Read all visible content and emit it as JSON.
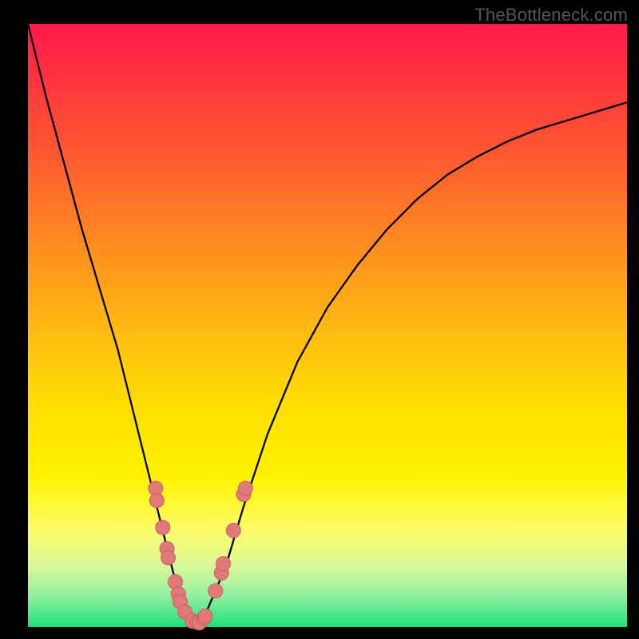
{
  "watermark": "TheBottleneck.com",
  "chart_data": {
    "type": "line",
    "title": "",
    "xlabel": "",
    "ylabel": "",
    "xlim": [
      0,
      100
    ],
    "ylim": [
      0,
      100
    ],
    "series": [
      {
        "name": "curve",
        "x": [
          0,
          3,
          6,
          9,
          12,
          15,
          17,
          19,
          21,
          23,
          24.5,
          26,
          27,
          28,
          29,
          30,
          33,
          36,
          40,
          45,
          50,
          55,
          60,
          65,
          70,
          75,
          80,
          85,
          90,
          95,
          100
        ],
        "values": [
          100,
          88,
          77,
          66,
          56,
          46,
          38,
          30,
          22,
          14,
          8,
          3,
          1,
          0.4,
          1,
          3,
          10,
          20,
          32,
          44,
          53,
          60,
          66,
          71,
          75,
          78,
          80.5,
          82.5,
          84,
          85.5,
          87
        ]
      }
    ],
    "points": [
      {
        "x": 21.3,
        "y": 23.0
      },
      {
        "x": 21.5,
        "y": 21.0
      },
      {
        "x": 22.5,
        "y": 16.5
      },
      {
        "x": 23.2,
        "y": 13.0
      },
      {
        "x": 23.4,
        "y": 11.5
      },
      {
        "x": 24.6,
        "y": 7.5
      },
      {
        "x": 25.1,
        "y": 5.5
      },
      {
        "x": 25.4,
        "y": 4.2
      },
      {
        "x": 26.2,
        "y": 2.5
      },
      {
        "x": 27.4,
        "y": 1.0
      },
      {
        "x": 28.2,
        "y": 0.8
      },
      {
        "x": 28.6,
        "y": 0.7
      },
      {
        "x": 29.4,
        "y": 1.5
      },
      {
        "x": 29.6,
        "y": 1.8
      },
      {
        "x": 31.3,
        "y": 6.0
      },
      {
        "x": 32.3,
        "y": 9.0
      },
      {
        "x": 32.6,
        "y": 10.5
      },
      {
        "x": 34.3,
        "y": 16.0
      },
      {
        "x": 36.0,
        "y": 22.0
      },
      {
        "x": 36.3,
        "y": 23.0
      }
    ],
    "colors": {
      "curve": "#000000",
      "points_fill": "#e07a7a",
      "points_stroke": "#c96060"
    }
  }
}
